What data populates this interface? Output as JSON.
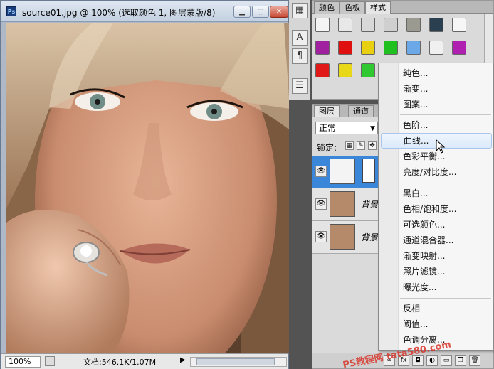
{
  "document": {
    "title": "source01.jpg @ 100% (选取颜色 1, 图层蒙版/8)",
    "zoom": "100%",
    "info": "文档:546.1K/1.07M"
  },
  "swatch_panel": {
    "tabs": [
      "颜色",
      "色板",
      "样式"
    ],
    "active_tab": "样式"
  },
  "layers_panel": {
    "tabs": [
      "图层",
      "通道"
    ],
    "blend_mode": "正常",
    "lock_label": "锁定:",
    "layers": [
      {
        "name": ""
      },
      {
        "name": "背景 副"
      },
      {
        "name": "背景"
      }
    ]
  },
  "context_menu": {
    "items": [
      {
        "label": "纯色..."
      },
      {
        "label": "渐变..."
      },
      {
        "label": "图案..."
      },
      {
        "label": "色阶..."
      },
      {
        "label": "曲线...",
        "highlighted": true
      },
      {
        "label": "色彩平衡..."
      },
      {
        "label": "亮度/对比度..."
      },
      {
        "label": "黑白..."
      },
      {
        "label": "色相/饱和度..."
      },
      {
        "label": "可选颜色..."
      },
      {
        "label": "通道混合器..."
      },
      {
        "label": "渐变映射..."
      },
      {
        "label": "照片滤镜..."
      },
      {
        "label": "曝光度..."
      },
      {
        "label": "反相"
      },
      {
        "label": "阈值..."
      },
      {
        "label": "色调分离..."
      }
    ]
  },
  "watermark": "PS教程网 tata580.com",
  "colors": {
    "selection": "#3a86d8",
    "menu_highlight": "#dbe9fa",
    "watermark": "#d8362a"
  }
}
